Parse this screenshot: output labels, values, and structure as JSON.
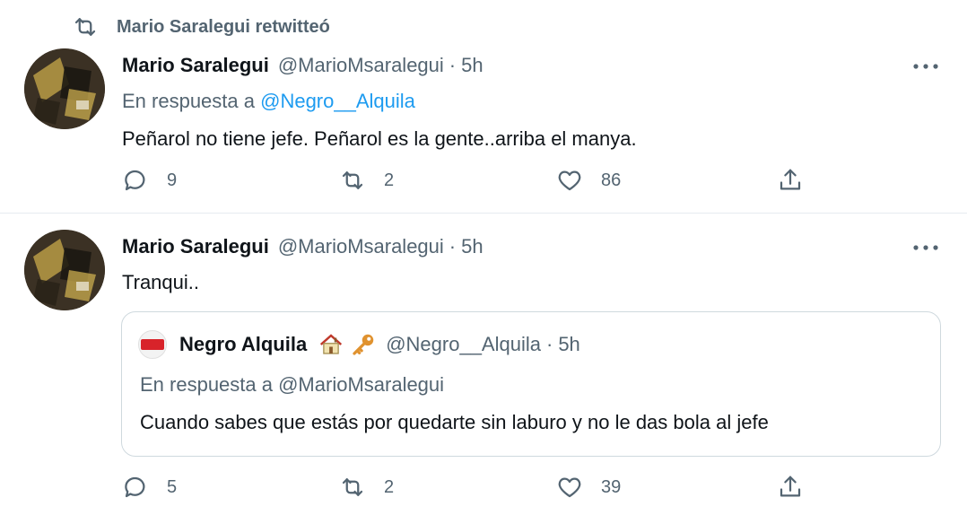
{
  "retweet_banner": {
    "icon": "retweet-icon",
    "text": "Mario Saralegui retwitteó"
  },
  "tweets": [
    {
      "author_name": "Mario Saralegui",
      "handle": "@MarioMsaralegui",
      "separator": "·",
      "time": "5h",
      "reply_prefix": "En respuesta a",
      "reply_mention": "@Negro__Alquila",
      "text": "Peñarol no tiene jefe. Peñarol es la gente..arriba el manya.",
      "replies": "9",
      "retweets": "2",
      "likes": "86"
    },
    {
      "author_name": "Mario Saralegui",
      "handle": "@MarioMsaralegui",
      "separator": "·",
      "time": "5h",
      "text": "Tranqui..",
      "replies": "5",
      "retweets": "2",
      "likes": "39",
      "quote": {
        "author_name": "Negro Alquila",
        "emojis": [
          "house-emoji",
          "key-emoji"
        ],
        "handle": "@Negro__Alquila",
        "separator": "·",
        "time": "5h",
        "reply_line": "En respuesta a @MarioMsaralegui",
        "text": "Cuando sabes que estás por quedarte sin laburo y no le das bola al jefe"
      }
    }
  ],
  "colors": {
    "primary_text": "#0f1419",
    "secondary_text": "#536471",
    "link": "#1d9bf0",
    "border": "#cfd9de"
  }
}
